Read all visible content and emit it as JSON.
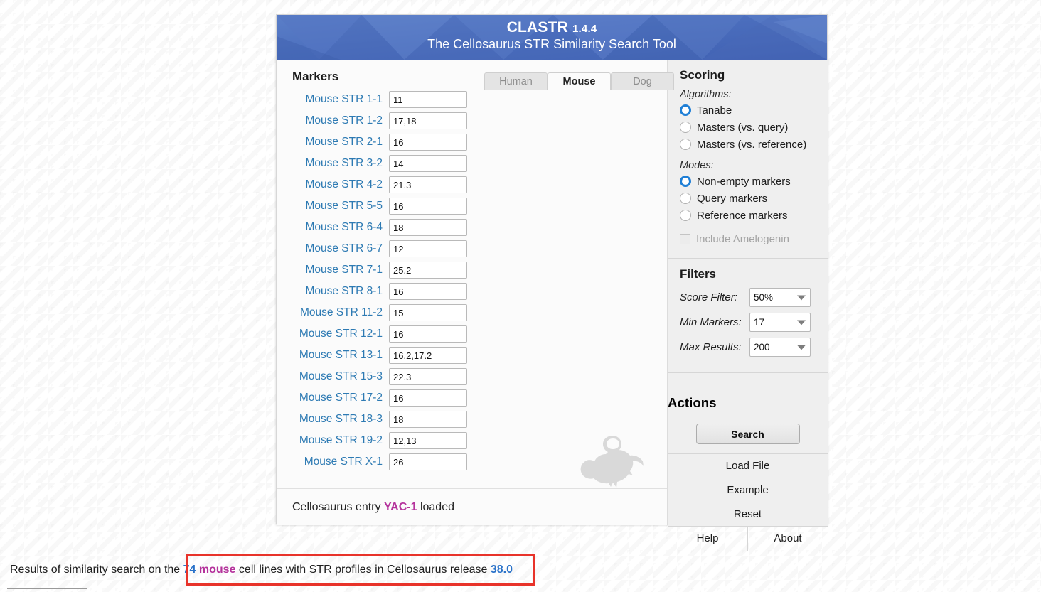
{
  "header": {
    "app_name": "CLASTR",
    "version": "1.4.4",
    "subtitle": "The Cellosaurus STR Similarity Search Tool"
  },
  "tabs": [
    {
      "id": "human",
      "label": "Human",
      "active": false
    },
    {
      "id": "mouse",
      "label": "Mouse",
      "active": true
    },
    {
      "id": "dog",
      "label": "Dog",
      "active": false
    }
  ],
  "markers": {
    "title": "Markers",
    "rows": [
      {
        "label": "Mouse STR 1-1",
        "value": "11"
      },
      {
        "label": "Mouse STR 1-2",
        "value": "17,18"
      },
      {
        "label": "Mouse STR 2-1",
        "value": "16"
      },
      {
        "label": "Mouse STR 3-2",
        "value": "14"
      },
      {
        "label": "Mouse STR 4-2",
        "value": "21.3"
      },
      {
        "label": "Mouse STR 5-5",
        "value": "16"
      },
      {
        "label": "Mouse STR 6-4",
        "value": "18"
      },
      {
        "label": "Mouse STR 6-7",
        "value": "12"
      },
      {
        "label": "Mouse STR 7-1",
        "value": "25.2"
      },
      {
        "label": "Mouse STR 8-1",
        "value": "16"
      },
      {
        "label": "Mouse STR 11-2",
        "value": "15"
      },
      {
        "label": "Mouse STR 12-1",
        "value": "16"
      },
      {
        "label": "Mouse STR 13-1",
        "value": "16.2,17.2"
      },
      {
        "label": "Mouse STR 15-3",
        "value": "22.3"
      },
      {
        "label": "Mouse STR 17-2",
        "value": "16"
      },
      {
        "label": "Mouse STR 18-3",
        "value": "18"
      },
      {
        "label": "Mouse STR 19-2",
        "value": "12,13"
      },
      {
        "label": "Mouse STR X-1",
        "value": "26"
      }
    ]
  },
  "status": {
    "prefix": "Cellosaurus entry ",
    "entry": "YAC-1",
    "suffix": " loaded"
  },
  "scoring": {
    "title": "Scoring",
    "algorithms_label": "Algorithms:",
    "algorithms": [
      {
        "label": "Tanabe",
        "selected": true
      },
      {
        "label": "Masters (vs. query)",
        "selected": false
      },
      {
        "label": "Masters (vs. reference)",
        "selected": false
      }
    ],
    "modes_label": "Modes:",
    "modes": [
      {
        "label": "Non-empty markers",
        "selected": true
      },
      {
        "label": "Query markers",
        "selected": false
      },
      {
        "label": "Reference markers",
        "selected": false
      }
    ],
    "amelogenin": {
      "label": "Include Amelogenin",
      "checked": false,
      "disabled": true
    }
  },
  "filters": {
    "title": "Filters",
    "rows": [
      {
        "label": "Score Filter:",
        "value": "50%"
      },
      {
        "label": "Min Markers:",
        "value": "17"
      },
      {
        "label": "Max Results:",
        "value": "200"
      }
    ]
  },
  "actions": {
    "title": "Actions",
    "search_label": "Search",
    "load_file_label": "Load File",
    "example_label": "Example",
    "reset_label": "Reset",
    "help_label": "Help",
    "about_label": "About"
  },
  "results": {
    "text_1": "Results of similarity search on the ",
    "count": "74",
    "species": " mouse",
    "text_2": " cell lines with STR profiles in Cellosaurus release ",
    "release": "38.0"
  },
  "colors": {
    "banner_blue": "#4c6fbe",
    "link_blue": "#2d7ab3",
    "accent_purple": "#b5339c",
    "highlight_red": "#e8332a",
    "radio_blue": "#1f7fd6"
  }
}
